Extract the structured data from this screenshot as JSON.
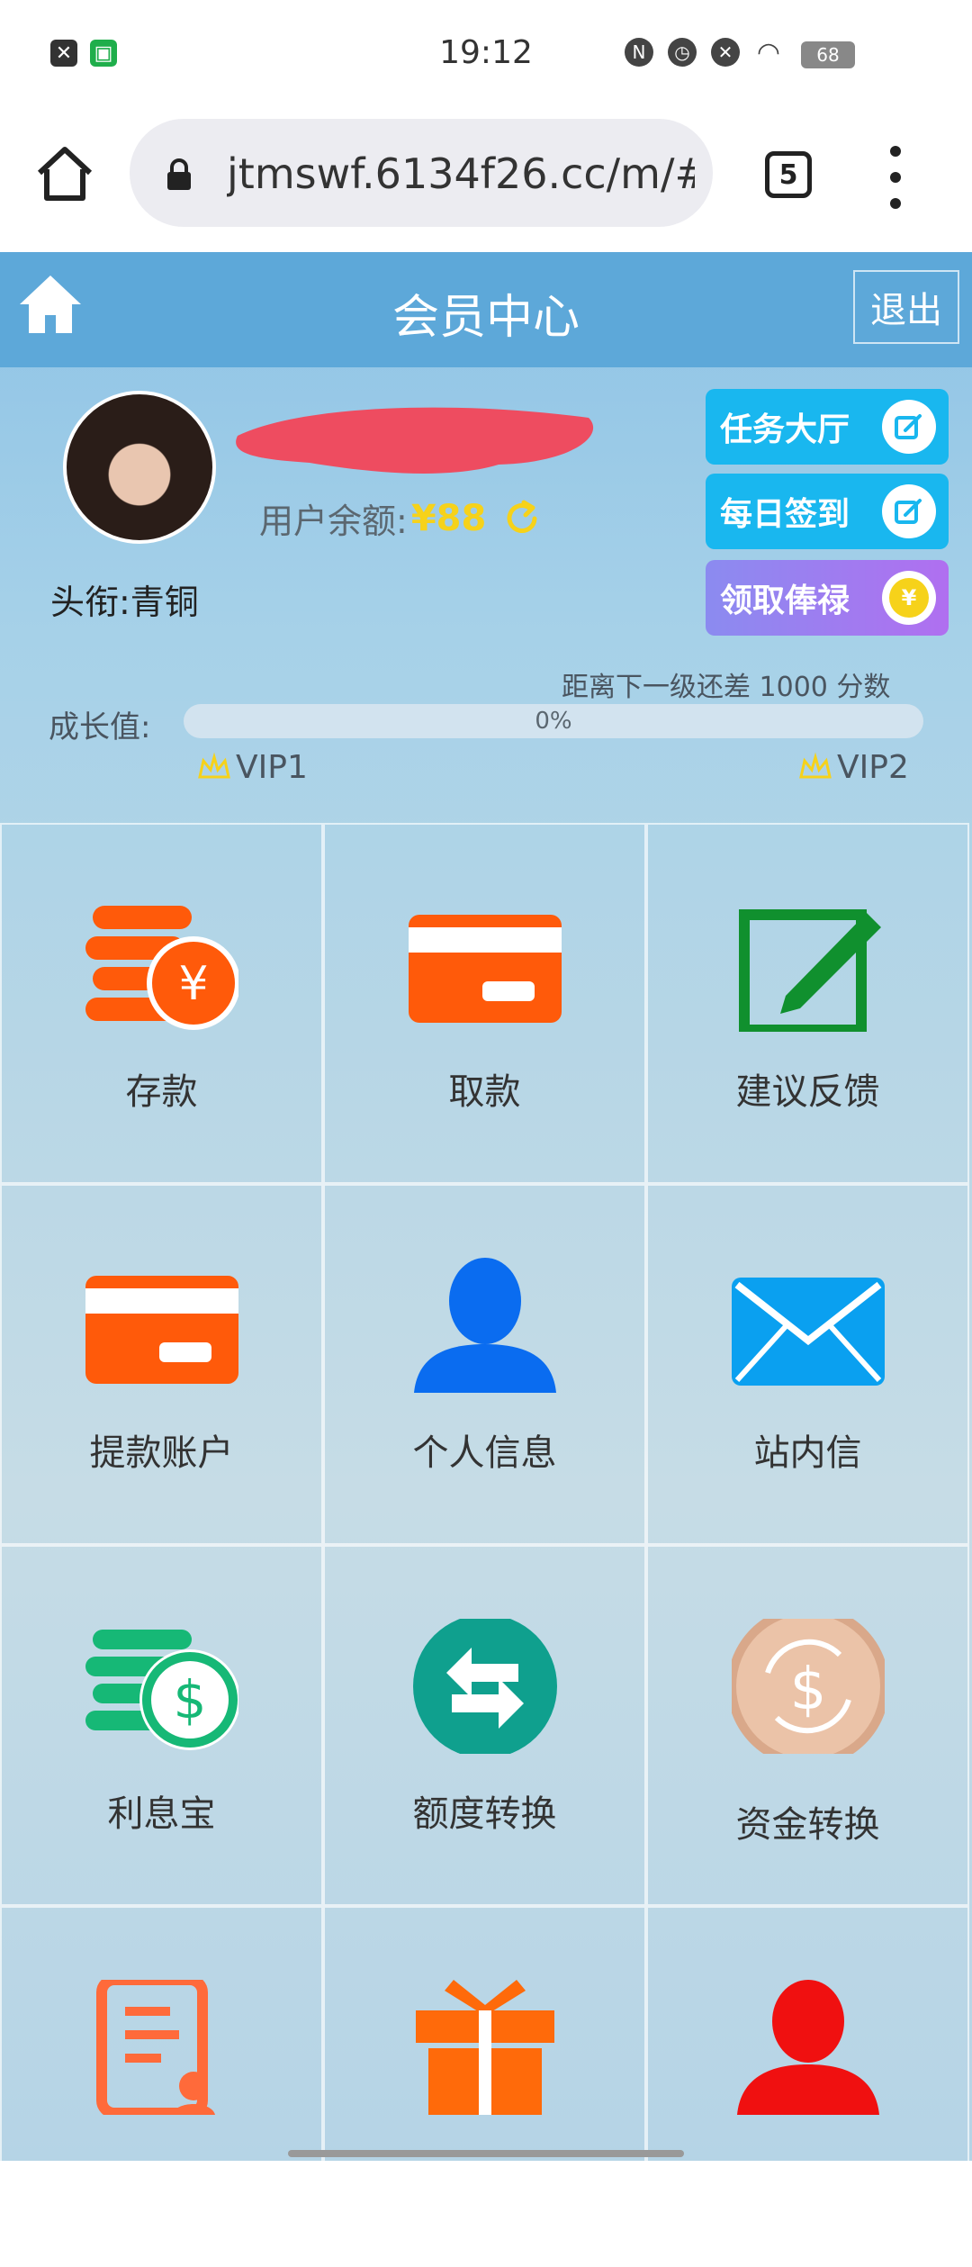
{
  "status_bar": {
    "time": "19:12",
    "battery": "68"
  },
  "browser": {
    "url": "jtmswf.6134f26.cc/m/#",
    "tab_count": "5"
  },
  "header": {
    "title": "会员中心",
    "logout_label": "退出"
  },
  "user": {
    "balance_label": "用户余额:",
    "balance_value": "¥88",
    "title_label": "头衔:青铜"
  },
  "side_buttons": {
    "task_hall": "任务大厅",
    "daily_signin": "每日签到",
    "claim_salary": "领取俸禄"
  },
  "growth": {
    "next_level_text": "距离下一级还差 1000 分数",
    "label": "成长值:",
    "percent_text": "0%",
    "progress": 0,
    "current_level": "VIP1",
    "next_level": "VIP2"
  },
  "grid": {
    "items": [
      {
        "label": "存款",
        "icon": "deposit-coins-icon"
      },
      {
        "label": "取款",
        "icon": "withdraw-card-icon"
      },
      {
        "label": "建议反馈",
        "icon": "feedback-edit-icon"
      },
      {
        "label": "提款账户",
        "icon": "withdraw-account-card-icon"
      },
      {
        "label": "个人信息",
        "icon": "user-profile-icon"
      },
      {
        "label": "站内信",
        "icon": "mail-envelope-icon"
      },
      {
        "label": "利息宝",
        "icon": "interest-coins-dollar-icon"
      },
      {
        "label": "额度转换",
        "icon": "quota-transfer-arrows-icon"
      },
      {
        "label": "资金转换",
        "icon": "fund-exchange-dollar-icon"
      },
      {
        "label": "",
        "icon": "record-document-icon"
      },
      {
        "label": "",
        "icon": "gift-box-icon"
      },
      {
        "label": "",
        "icon": "agent-user-icon"
      }
    ]
  },
  "colors": {
    "header": "#5da8d9",
    "accent_orange": "#ff5a0a",
    "balance_yellow": "#f6d21a",
    "button_blue": "#19b7ef"
  }
}
